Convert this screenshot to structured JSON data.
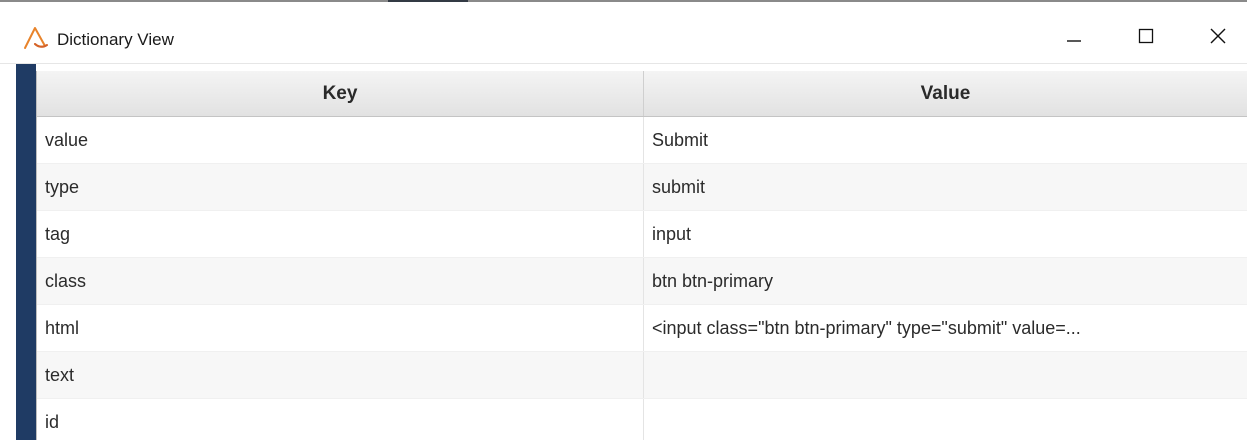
{
  "window": {
    "title": "Dictionary View",
    "icon": "app-logo-icon",
    "controls": [
      "minimize-icon",
      "maximize-icon",
      "close-icon"
    ]
  },
  "table": {
    "headers": {
      "key": "Key",
      "value": "Value"
    },
    "rows": [
      {
        "key": "value",
        "value": "Submit"
      },
      {
        "key": "type",
        "value": "submit"
      },
      {
        "key": "tag",
        "value": "input"
      },
      {
        "key": "class",
        "value": "btn btn-primary"
      },
      {
        "key": "html",
        "value": "<input class=\"btn btn-primary\" type=\"submit\" value=..."
      },
      {
        "key": "text",
        "value": ""
      },
      {
        "key": "id",
        "value": ""
      }
    ]
  },
  "colors": {
    "side_stripe": "#1f3b64",
    "app_icon": "#e8832a"
  }
}
